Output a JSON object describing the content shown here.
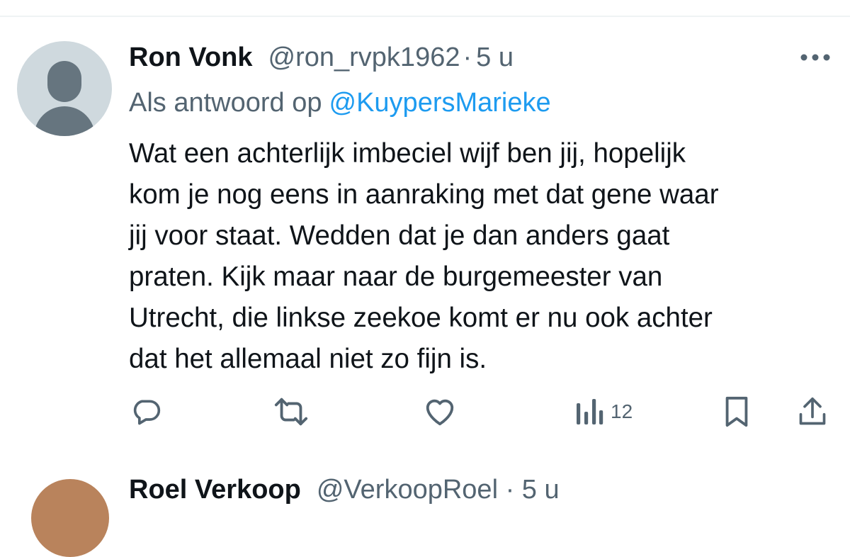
{
  "tweet": {
    "display_name": "Ron Vonk",
    "handle": "@ron_rvpk1962",
    "separator": "·",
    "time": "5 u",
    "reply_prefix": "Als antwoord op",
    "reply_to": "@KuypersMarieke",
    "text": "Wat een achterlijk imbeciel wijf ben jij, hopelijk\nkom je nog eens in aanraking met dat gene waar\njij voor staat. Wedden dat je dan anders gaat\npraten. Kijk maar naar de burgemeester van\nUtrecht, die linkse zeekoe komt er nu ook achter\ndat het allemaal niet zo fijn is.",
    "actions": {
      "reply_icon": "reply-icon",
      "retweet_icon": "retweet-icon",
      "like_icon": "heart-icon",
      "views_icon": "views-icon",
      "views_count": "12",
      "bookmark_icon": "bookmark-icon",
      "share_icon": "share-icon"
    }
  },
  "next_tweet": {
    "display_name": "Roel Verkoop",
    "handle": "@VerkoopRoel · 5 u"
  },
  "colors": {
    "text_primary": "#0f1419",
    "text_secondary": "#536471",
    "accent": "#1d9bf0",
    "avatar_bg": "#cfd9de",
    "divider": "#eff3f4"
  }
}
